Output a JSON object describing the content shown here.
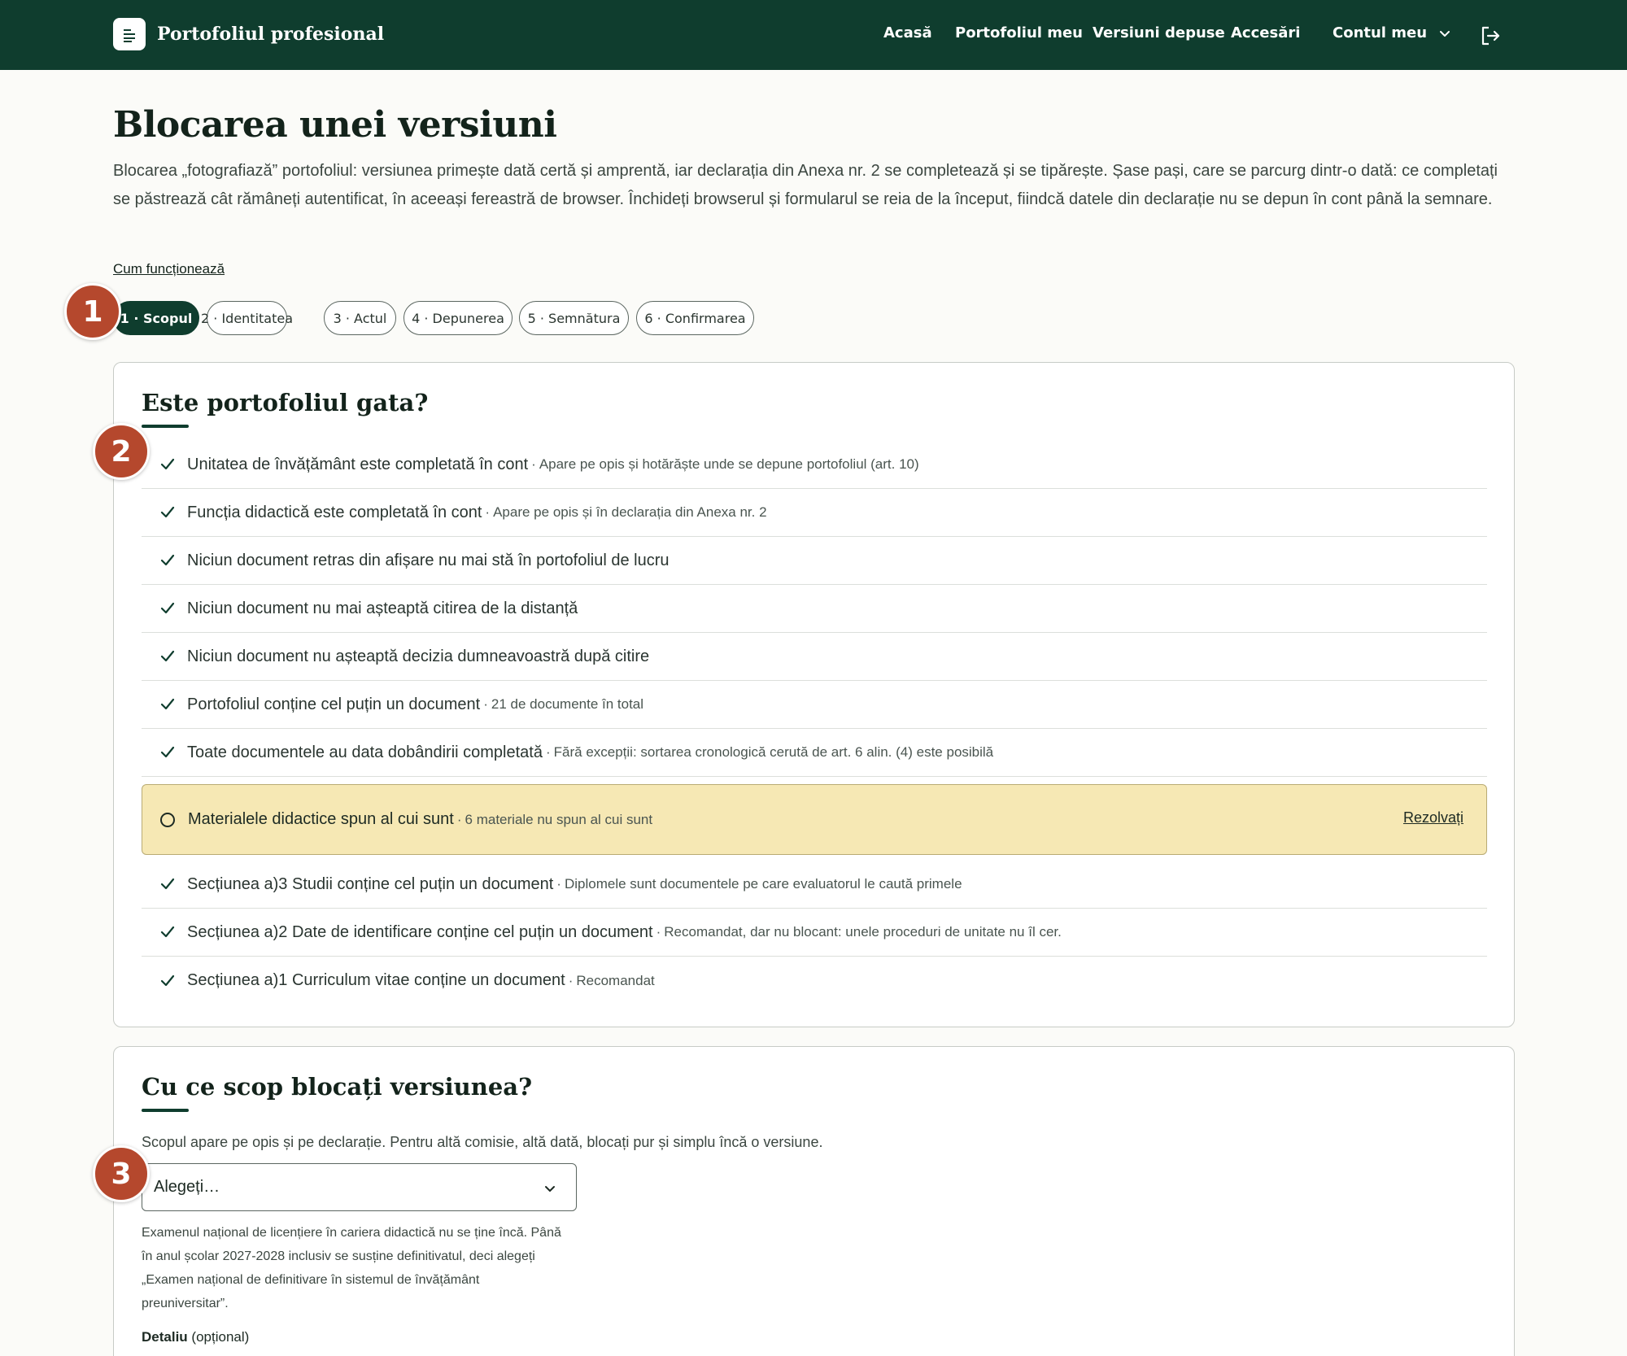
{
  "header": {
    "brand": "Portofoliul profesional",
    "nav": [
      "Acasă",
      "Portofoliul meu",
      "Versiuni depuse",
      "Accesări"
    ],
    "account": "Contul meu",
    "bg_color": "#0f3d2e"
  },
  "page": {
    "title": "Blocarea unei versiuni",
    "intro": "Blocarea „fotografiază” portofoliul: versiunea primește dată certă și amprentă, iar declarația din Anexa nr. 2 se completează și se tipărește. Șase pași, care se parcurg dintr-o dată: ce completați se păstrează cât rămâneți autentificat, în aceeași fereastră de browser. Închideți browserul și formularul se reia de la început, fiindcă datele din declarație nu se depun în cont până la semnare.",
    "how_link": "Cum funcționează"
  },
  "steps": [
    "1 · Scopul",
    "2 · Identitatea",
    "3 · Actul",
    "4 · Depunerea",
    "5 · Semnătura",
    "6 · Confirmarea"
  ],
  "badges": [
    "1",
    "2",
    "3"
  ],
  "ready": {
    "title": "Este portofoliul gata?",
    "items": [
      {
        "main": "Unitatea de învățământ este completată în cont",
        "note": "Apare pe opis și hotărăște unde se depune portofoliul (art. 10)"
      },
      {
        "main": "Funcția didactică este completată în cont",
        "note": "Apare pe opis și în declarația din Anexa nr. 2"
      },
      {
        "main": "Niciun document retras din afișare nu mai stă în portofoliul de lucru",
        "note": ""
      },
      {
        "main": "Niciun document nu mai așteaptă citirea de la distanță",
        "note": ""
      },
      {
        "main": "Niciun document nu așteaptă decizia dumneavoastră după citire",
        "note": ""
      },
      {
        "main": "Portofoliul conține cel puțin un document",
        "note": "21 de documente în total"
      },
      {
        "main": "Toate documentele au data dobândirii completată",
        "note": "Fără excepții: sortarea cronologică cerută de art. 6 alin. (4) este posibilă"
      }
    ],
    "warning": {
      "main": "Materialele didactice spun al cui sunt",
      "note": "6 materiale nu spun al cui sunt",
      "action": "Rezolvați",
      "color": "#f6e8b4"
    },
    "items_after": [
      {
        "main": "Secțiunea a)3 Studii conține cel puțin un document",
        "note": "Diplomele sunt documentele pe care evaluatorul le caută primele"
      },
      {
        "main": "Secțiunea a)2 Date de identificare conține cel puțin un document",
        "note": "Recomandat, dar nu blocant: unele proceduri de unitate nu îl cer."
      },
      {
        "main": "Secțiunea a)1 Curriculum vitae conține un document",
        "note": "Recomandat"
      }
    ]
  },
  "purpose": {
    "title": "Cu ce scop blocați versiunea?",
    "desc": "Scopul apare pe opis și pe declarație. Pentru altă comisie, altă dată, blocați pur și simplu încă o versiune.",
    "select_value": "Alegeți…",
    "hint": "Examenul național de licențiere în cariera didactică nu se ține încă. Până în anul școlar 2027-2028 inclusiv se susține definitivatul, deci alegeți „Examen național de definitivare în sistemul de învățământ preuniversitar”.",
    "detail_label": "Detaliu",
    "detail_optional": "(opțional)"
  }
}
